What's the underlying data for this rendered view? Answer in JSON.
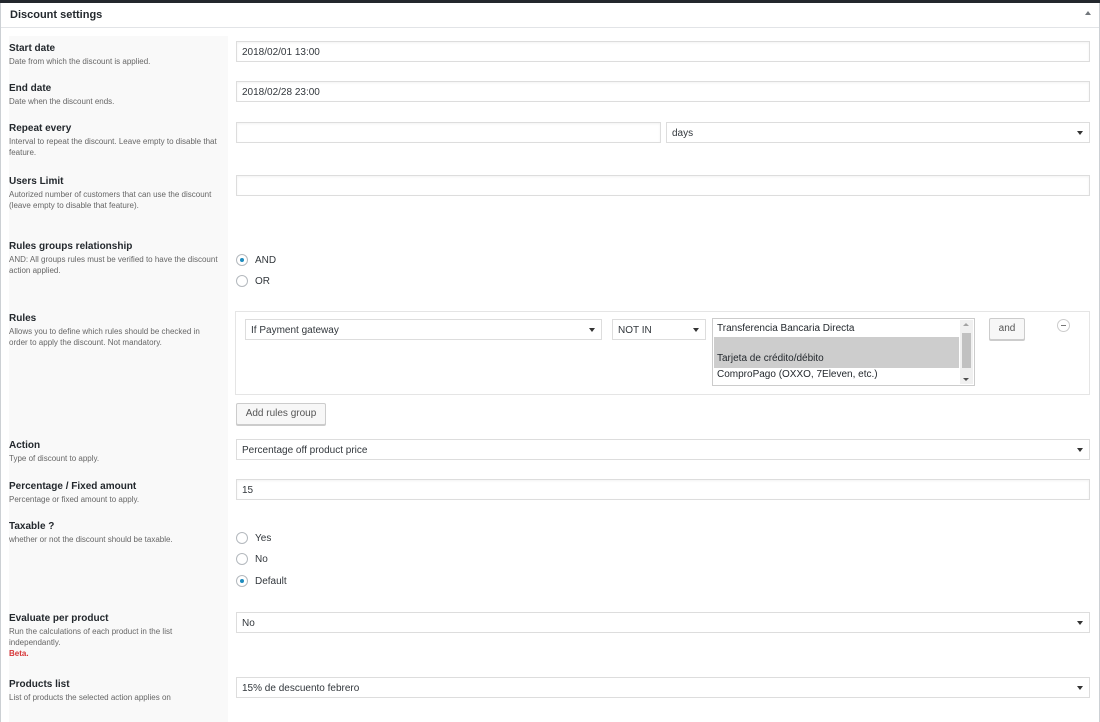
{
  "panel": {
    "title": "Discount settings"
  },
  "fields": {
    "start_date": {
      "label": "Start date",
      "desc": "Date from which the discount is applied.",
      "value": "2018/02/01 13:00"
    },
    "end_date": {
      "label": "End date",
      "desc": "Date when the discount ends.",
      "value": "2018/02/28 23:00"
    },
    "repeat_every": {
      "label": "Repeat every",
      "desc": "Interval to repeat the discount. Leave empty to disable that feature.",
      "value": "",
      "unit": "days"
    },
    "users_limit": {
      "label": "Users Limit",
      "desc": "Autorized number of customers that can use the discount (leave empty to disable that feature).",
      "value": ""
    },
    "rules_relationship": {
      "label": "Rules groups relationship",
      "desc": "AND: All groups rules must be verified to have the discount action applied.",
      "options": [
        "AND",
        "OR"
      ],
      "selected": "AND"
    },
    "rules": {
      "label": "Rules",
      "desc": "Allows you to define which rules should be checked in order to apply the discount. Not mandatory.",
      "condition": "If Payment gateway",
      "operator": "NOT IN",
      "values": [
        "Transferencia Bancaria Directa",
        "Tarjeta de crédito/débito",
        "ComproPago (OXXO, 7Eleven, etc.)"
      ],
      "selected_values": [
        "Tarjeta de crédito/débito"
      ],
      "and_button": "and",
      "add_group_button": "Add rules group"
    },
    "action": {
      "label": "Action",
      "desc": "Type of discount to apply.",
      "value": "Percentage off product price"
    },
    "amount": {
      "label": "Percentage / Fixed amount",
      "desc": "Percentage or fixed amount to apply.",
      "value": "15"
    },
    "taxable": {
      "label": "Taxable ?",
      "desc": "whether or not the discount should be taxable.",
      "options": [
        "Yes",
        "No",
        "Default"
      ],
      "selected": "Default"
    },
    "evaluate_per_product": {
      "label": "Evaluate per product",
      "desc": "Run the calculations of each product in the list independantly.",
      "beta": "Beta.",
      "value": "No"
    },
    "products_list": {
      "label": "Products list",
      "desc": "List of products the selected action applies on",
      "value": "15% de descuento febrero"
    }
  }
}
